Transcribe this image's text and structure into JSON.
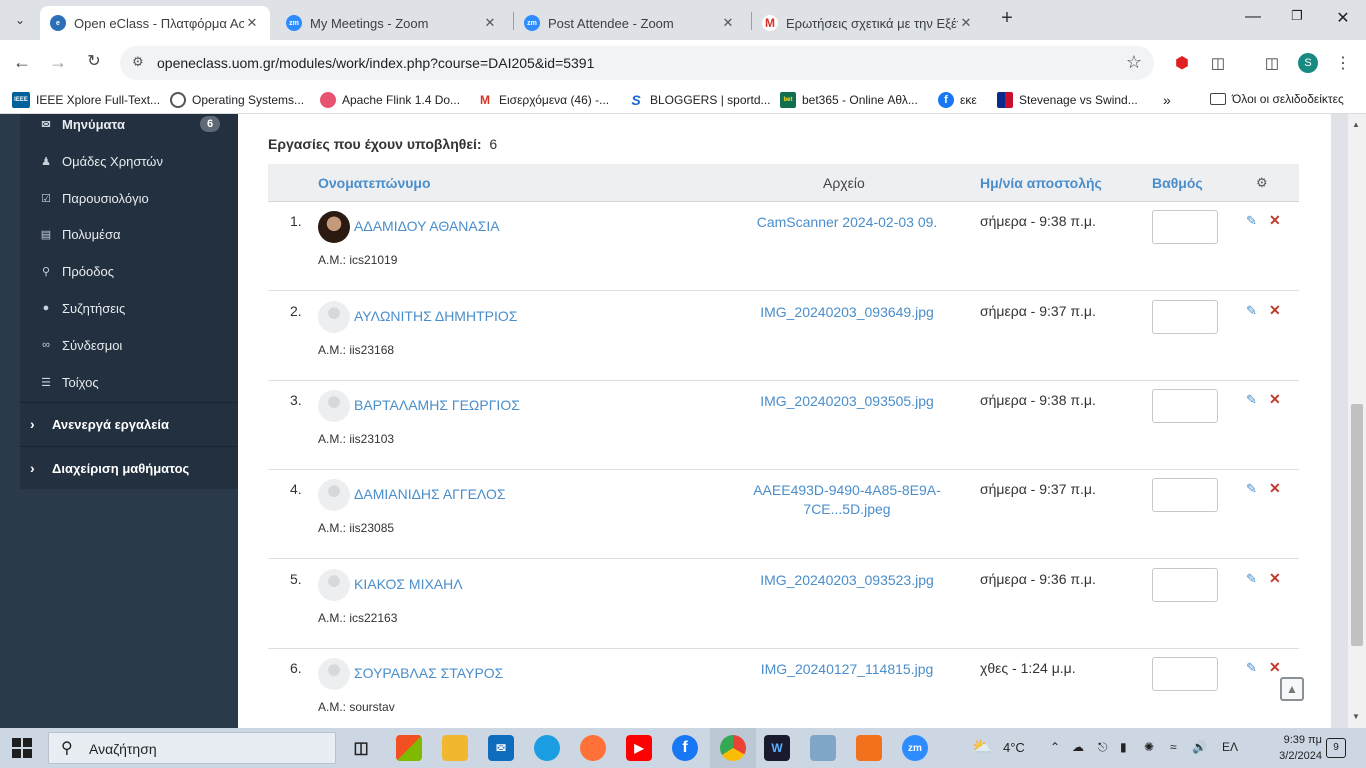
{
  "browser": {
    "tabs": [
      {
        "title": "Open eClass - Πλατφόρμα Ασύ",
        "active": true
      },
      {
        "title": "My Meetings - Zoom",
        "active": false
      },
      {
        "title": "Post Attendee - Zoom",
        "active": false
      },
      {
        "title": "Ερωτήσεις σχετικά με την Εξέτ",
        "active": false
      }
    ],
    "url": "openeclass.uom.gr/modules/work/index.php?course=DAI205&id=5391",
    "profile_initial": "S",
    "bookmarks": [
      {
        "label": "IEEE Xplore Full-Text...",
        "badge": "IEEE"
      },
      {
        "label": "Operating Systems...",
        "badge": ""
      },
      {
        "label": "Apache Flink 1.4 Do...",
        "badge": ""
      },
      {
        "label": "Εισερχόμενα (46) -...",
        "badge": ""
      },
      {
        "label": "BLOGGERS | sportd...",
        "badge": "S"
      },
      {
        "label": "bet365 - Online Αθλ...",
        "badge": "bet"
      },
      {
        "label": "εκε",
        "badge": "f"
      },
      {
        "label": "Stevenage vs Swind...",
        "badge": ""
      }
    ],
    "all_bookmarks": "Όλοι οι σελιδοδείκτες"
  },
  "sidebar": {
    "items": [
      {
        "label": "Μηνύματα",
        "badge": "6"
      },
      {
        "label": "Ομάδες Χρηστών"
      },
      {
        "label": "Παρουσιολόγιο"
      },
      {
        "label": "Πολυμέσα"
      },
      {
        "label": "Πρόοδος"
      },
      {
        "label": "Συζητήσεις"
      },
      {
        "label": "Σύνδεσμοι"
      },
      {
        "label": "Τοίχος"
      }
    ],
    "groups": [
      "Ανενεργά εργαλεία",
      "Διαχείριση μαθήματος"
    ]
  },
  "main": {
    "summary_label": "Εργασίες που έχουν υποβληθεί:",
    "summary_value": "6",
    "columns": {
      "name": "Ονοματεπώνυμο",
      "file": "Αρχείο",
      "date": "Ημ/νία αποστολής",
      "grade": "Βαθμός"
    },
    "rows": [
      {
        "num": "1.",
        "name": "ΑΔΑΜΙΔΟΥ ΑΘΑΝΑΣΙΑ",
        "am": "Α.Μ.: ics21019",
        "file": "CamScanner 2024-02-03 09.",
        "date": "σήμερα - 9:38 π.μ.",
        "photo": true
      },
      {
        "num": "2.",
        "name": "ΑΥΛΩΝΙΤΗΣ ΔΗΜΗΤΡΙΟΣ",
        "am": "Α.Μ.: iis23168",
        "file": "IMG_20240203_093649.jpg",
        "date": "σήμερα - 9:37 π.μ.",
        "photo": false
      },
      {
        "num": "3.",
        "name": "ΒΑΡΤΑΛΑΜΗΣ ΓΕΩΡΓΙΟΣ",
        "am": "Α.Μ.: iis23103",
        "file": "IMG_20240203_093505.jpg",
        "date": "σήμερα - 9:38 π.μ.",
        "photo": false
      },
      {
        "num": "4.",
        "name": "ΔΑΜΙΑΝΙΔΗΣ ΑΓΓΕΛΟΣ",
        "am": "Α.Μ.: iis23085",
        "file": "AAEE493D-9490-4A85-8E9A-7CE...5D.jpeg",
        "date": "σήμερα - 9:37 π.μ.",
        "photo": false
      },
      {
        "num": "5.",
        "name": "ΚΙΑΚΟΣ ΜΙΧΑΗΛ",
        "am": "Α.Μ.: ics22163",
        "file": "IMG_20240203_093523.jpg",
        "date": "σήμερα - 9:36 π.μ.",
        "photo": false
      },
      {
        "num": "6.",
        "name": "ΣΟΥΡΑΒΛΑΣ ΣΤΑΥΡΟΣ",
        "am": "Α.Μ.: sourstav",
        "file": "IMG_20240127_114815.jpg",
        "date": "χθες - 1:24 μ.μ.",
        "photo": false
      }
    ]
  },
  "taskbar": {
    "search_placeholder": "Αναζήτηση",
    "weather": "4°C",
    "language": "ΕΛ",
    "time": "9:39 πμ",
    "date": "3/2/2024",
    "notifications": "9"
  },
  "colors": {
    "link": "#4a8ecb",
    "sidebar_bg": "#22303f",
    "delete": "#c0392b"
  }
}
